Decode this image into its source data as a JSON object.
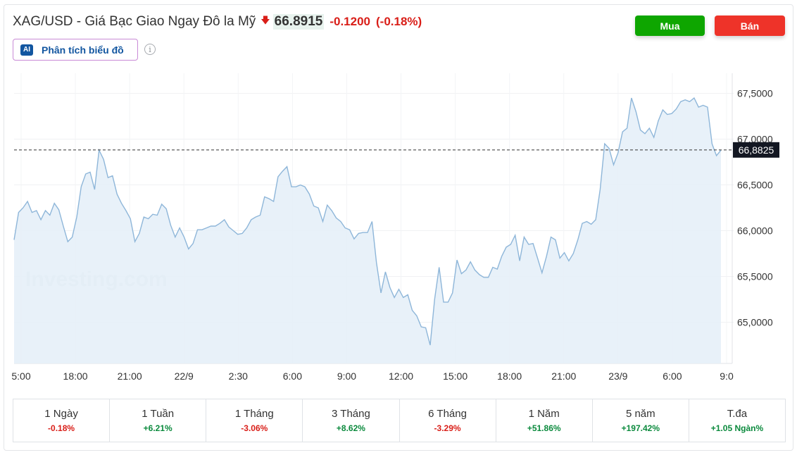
{
  "header": {
    "title": "XAG/USD - Giá Bạc Giao Ngay Đô la Mỹ",
    "direction_icon": "arrow-down-icon",
    "price": "66.8915",
    "change": "-0.1200",
    "change_pct": "(-0.18%)"
  },
  "actions": {
    "buy_label": "Mua",
    "sell_label": "Bán"
  },
  "ai_analysis": {
    "icon_label": "AI",
    "label": "Phân tích biểu đồ",
    "info_icon": "info-icon"
  },
  "colors": {
    "line": "#8eb6d9",
    "area": "#e6f0f8",
    "negative": "#d91e18",
    "positive": "#0b8a3d",
    "buy": "#0ea600",
    "sell": "#ee3329",
    "price_tag": "#131722"
  },
  "chart_data": {
    "type": "area",
    "watermark": "Investing.com",
    "x_ticks": [
      "5:00",
      "18:00",
      "21:00",
      "22/9",
      "2:30",
      "6:00",
      "9:00",
      "12:00",
      "15:00",
      "18:00",
      "21:00",
      "23/9",
      "6:00",
      "9:0"
    ],
    "y_ticks": [
      "67,5000",
      "67,0000",
      "66,5000",
      "66,0000",
      "65,5000",
      "65,0000"
    ],
    "y_tick_values": [
      67.5,
      67.0,
      66.5,
      66.0,
      65.5,
      65.0
    ],
    "current_label": "66,8825",
    "current_value": 66.8825,
    "ylim": [
      64.55,
      67.72
    ],
    "series": [
      {
        "values": [
          65.9,
          66.2,
          66.25,
          66.32,
          66.2,
          66.22,
          66.12,
          66.22,
          66.17,
          66.3,
          66.23,
          66.05,
          65.88,
          65.93,
          66.15,
          66.48,
          66.62,
          66.64,
          66.45,
          66.88,
          66.78,
          66.58,
          66.6,
          66.4,
          66.3,
          66.22,
          66.13,
          65.88,
          65.97,
          66.15,
          66.13,
          66.18,
          66.17,
          66.29,
          66.24,
          66.06,
          65.93,
          66.03,
          65.93,
          65.8,
          65.86,
          66.01,
          66.01,
          66.03,
          66.05,
          66.05,
          66.08,
          66.12,
          66.04,
          66.0,
          65.96,
          65.97,
          66.03,
          66.12,
          66.15,
          66.17,
          66.37,
          66.35,
          66.32,
          66.59,
          66.65,
          66.7,
          66.48,
          66.48,
          66.5,
          66.48,
          66.4,
          66.27,
          66.25,
          66.1,
          66.28,
          66.22,
          66.14,
          66.1,
          66.03,
          66.01,
          65.91,
          65.97,
          65.98,
          65.98,
          66.1,
          65.65,
          65.32,
          65.55,
          65.38,
          65.27,
          65.36,
          65.27,
          65.3,
          65.13,
          65.07,
          64.95,
          64.94,
          64.75,
          65.25,
          65.6,
          65.22,
          65.22,
          65.32,
          65.68,
          65.53,
          65.57,
          65.66,
          65.57,
          65.52,
          65.49,
          65.49,
          65.6,
          65.58,
          65.72,
          65.82,
          65.85,
          65.95,
          65.67,
          65.93,
          65.85,
          65.86,
          65.7,
          65.54,
          65.72,
          65.93,
          65.9,
          65.7,
          65.76,
          65.67,
          65.75,
          65.9,
          66.08,
          66.1,
          66.07,
          66.12,
          66.45,
          66.95,
          66.9,
          66.72,
          66.85,
          67.08,
          67.12,
          67.45,
          67.3,
          67.1,
          67.06,
          67.12,
          67.02,
          67.2,
          67.32,
          67.27,
          67.28,
          67.33,
          67.41,
          67.43,
          67.41,
          67.45,
          67.35,
          67.37,
          67.35,
          66.95,
          66.82,
          66.88
        ]
      }
    ]
  },
  "periods": [
    {
      "label": "1 Ngày",
      "value": "-0.18%",
      "trend": "neg"
    },
    {
      "label": "1 Tuần",
      "value": "+6.21%",
      "trend": "pos"
    },
    {
      "label": "1 Tháng",
      "value": "-3.06%",
      "trend": "neg"
    },
    {
      "label": "3 Tháng",
      "value": "+8.62%",
      "trend": "pos"
    },
    {
      "label": "6 Tháng",
      "value": "-3.29%",
      "trend": "neg"
    },
    {
      "label": "1 Năm",
      "value": "+51.86%",
      "trend": "pos"
    },
    {
      "label": "5 năm",
      "value": "+197.42%",
      "trend": "pos"
    },
    {
      "label": "T.đa",
      "value": "+1.05 Ngàn%",
      "trend": "pos"
    }
  ]
}
